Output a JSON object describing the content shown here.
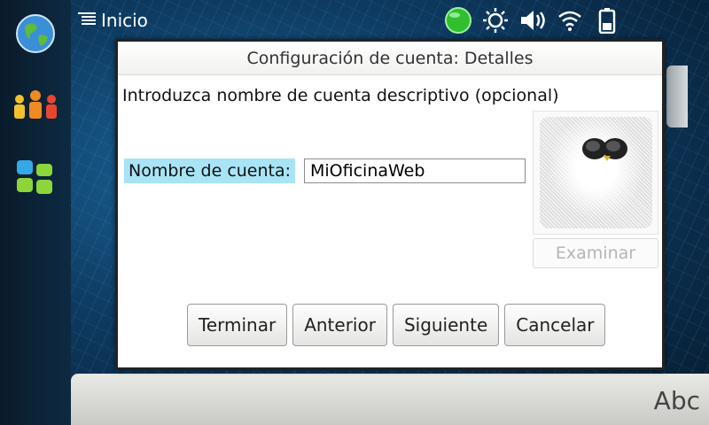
{
  "statusbar": {
    "title": "Inicio",
    "icons": [
      "menu-icon",
      "presence-icon",
      "brightness-icon",
      "volume-icon",
      "wifi-icon",
      "battery-icon"
    ],
    "presence_color": "#33cc33"
  },
  "rail": {
    "icons": [
      "globe-icon",
      "contacts-icon",
      "apps-icon"
    ]
  },
  "dialog": {
    "title": "Configuración de cuenta: Detalles",
    "instruction": "Introduzca nombre de cuenta descriptivo (opcional)",
    "field_label": "Nombre de cuenta:",
    "field_value": "MiOficinaWeb",
    "browse_label": "Examinar",
    "buttons": {
      "finish": "Terminar",
      "previous": "Anterior",
      "next": "Siguiente",
      "cancel": "Cancelar"
    }
  },
  "bottom": {
    "input_mode": "Abc"
  }
}
